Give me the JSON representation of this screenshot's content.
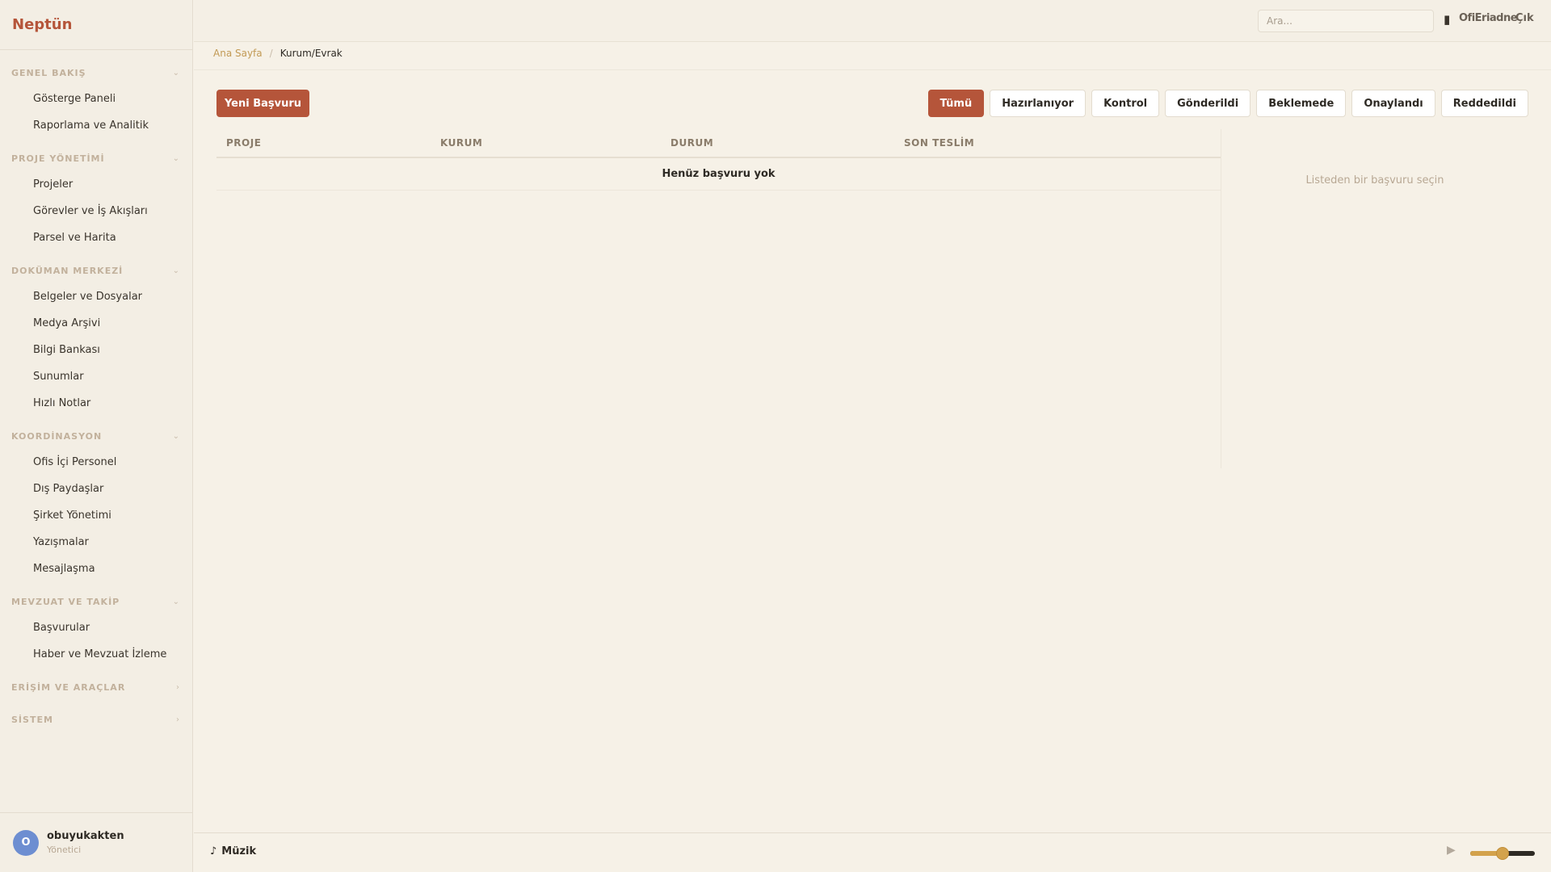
{
  "app": {
    "brand": "Neptün"
  },
  "sidebar": {
    "sections": [
      {
        "label": "GENEL BAKIŞ",
        "items": [
          "Gösterge Paneli",
          "Raporlama ve Analitik"
        ]
      },
      {
        "label": "PROJE YÖNETİMİ",
        "items": [
          "Projeler",
          "Görevler ve İş Akışları",
          "Parsel ve Harita"
        ]
      },
      {
        "label": "DOKÜMAN MERKEZİ",
        "items": [
          "Belgeler ve Dosyalar",
          "Medya Arşivi",
          "Bilgi Bankası",
          "Sunumlar",
          "Hızlı Notlar"
        ]
      },
      {
        "label": "KOORDİNASYON",
        "items": [
          "Ofis İçi Personel",
          "Dış Paydaşlar",
          "Şirket Yönetimi",
          "Yazışmalar",
          "Mesajlaşma"
        ]
      },
      {
        "label": "MEVZUAT VE TAKİP",
        "items": [
          "Başvurular",
          "Haber ve Mevzuat İzleme"
        ]
      },
      {
        "label": "ERİŞİM VE ARAÇLAR",
        "items": []
      },
      {
        "label": "SİSTEM",
        "items": []
      }
    ]
  },
  "user": {
    "initial": "O",
    "name": "obuyukakten",
    "role": "Yönetici"
  },
  "topbar": {
    "search_placeholder": "Ara...",
    "user_label": "OfiEriadne",
    "logout_label": "Çık"
  },
  "breadcrumb": {
    "home": "Ana Sayfa",
    "separator": "/",
    "current": "Kurum/Evrak"
  },
  "toolbar": {
    "new_button": "Yeni Başvuru",
    "filters": [
      "Tümü",
      "Hazırlanıyor",
      "Kontrol",
      "Gönderildi",
      "Beklemede",
      "Onaylandı",
      "Reddedildi"
    ],
    "active_filter": "Tümü"
  },
  "table": {
    "columns": [
      "PROJE",
      "KURUM",
      "DURUM",
      "SON TESLİM"
    ],
    "empty_text": "Henüz başvuru yok"
  },
  "detail": {
    "hint": "Listeden bir başvuru seçin"
  },
  "player": {
    "label": "Müzik",
    "volume": 0.5
  }
}
